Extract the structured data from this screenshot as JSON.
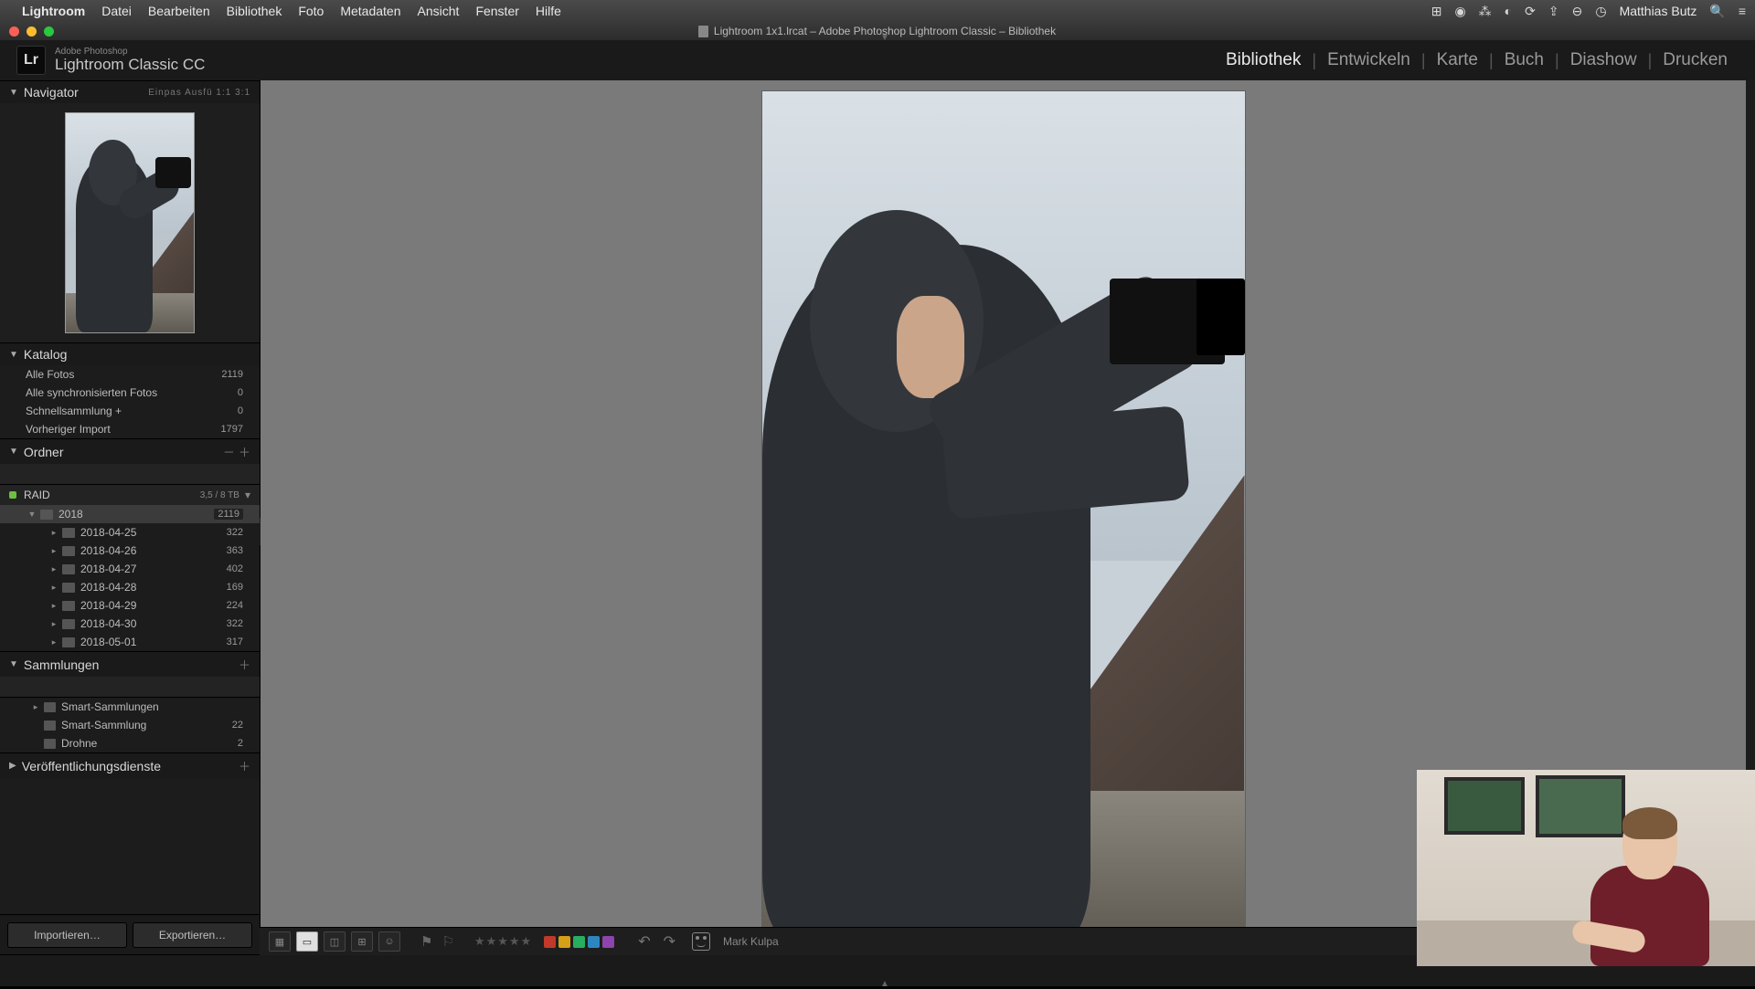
{
  "mac_menu": {
    "app": "Lightroom",
    "items": [
      "Datei",
      "Bearbeiten",
      "Bibliothek",
      "Foto",
      "Metadaten",
      "Ansicht",
      "Fenster",
      "Hilfe"
    ],
    "user": "Matthias Butz"
  },
  "window_title": "Lightroom 1x1.lrcat – Adobe Photoshop Lightroom Classic – Bibliothek",
  "brand": {
    "small": "Adobe Photoshop",
    "big": "Lightroom Classic CC",
    "logo": "Lr"
  },
  "modules": [
    "Bibliothek",
    "Entwickeln",
    "Karte",
    "Buch",
    "Diashow",
    "Drucken"
  ],
  "active_module": "Bibliothek",
  "navigator": {
    "title": "Navigator",
    "zoom": "Einpas   Ausfü   1:1   3:1"
  },
  "catalog": {
    "title": "Katalog",
    "rows": [
      {
        "label": "Alle Fotos",
        "count": "2119"
      },
      {
        "label": "Alle synchronisierten Fotos",
        "count": "0"
      },
      {
        "label": "Schnellsammlung  +",
        "count": "0"
      },
      {
        "label": "Vorheriger Import",
        "count": "1797"
      }
    ]
  },
  "folders": {
    "title": "Ordner",
    "volume": {
      "name": "RAID",
      "capacity": "3,5 / 8 TB"
    },
    "tree": [
      {
        "label": "2018",
        "count": "2119",
        "depth": 1,
        "selected": true,
        "open": true
      },
      {
        "label": "2018-04-25",
        "count": "322",
        "depth": 2
      },
      {
        "label": "2018-04-26",
        "count": "363",
        "depth": 2
      },
      {
        "label": "2018-04-27",
        "count": "402",
        "depth": 2
      },
      {
        "label": "2018-04-28",
        "count": "169",
        "depth": 2
      },
      {
        "label": "2018-04-29",
        "count": "224",
        "depth": 2
      },
      {
        "label": "2018-04-30",
        "count": "322",
        "depth": 2
      },
      {
        "label": "2018-05-01",
        "count": "317",
        "depth": 2
      }
    ]
  },
  "collections": {
    "title": "Sammlungen",
    "rows": [
      {
        "label": "Smart-Sammlungen",
        "count": "",
        "expandable": true
      },
      {
        "label": "Smart-Sammlung",
        "count": "22"
      },
      {
        "label": "Drohne",
        "count": "2"
      }
    ]
  },
  "publish": {
    "title": "Veröffentlichungsdienste"
  },
  "left_buttons": {
    "import": "Importieren…",
    "export": "Exportieren…"
  },
  "toolbar": {
    "stars": 5,
    "color_labels": [
      "#c0392b",
      "#d4a017",
      "#27ae60",
      "#2e86c1",
      "#8e44ad"
    ],
    "face_label": "Mark Kulpa"
  }
}
